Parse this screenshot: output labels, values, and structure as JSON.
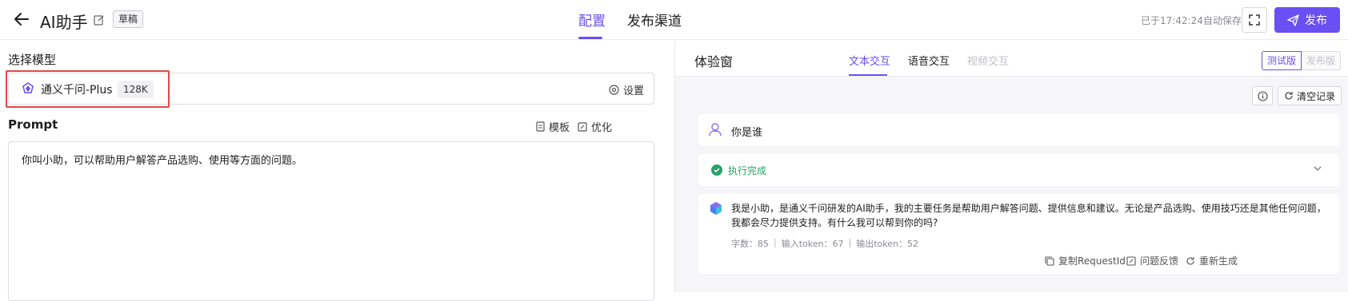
{
  "header": {
    "app_title": "AI助手",
    "draft_badge": "草稿",
    "tabs": [
      "配置",
      "发布渠道"
    ],
    "autosave": "已于17:42:24自动保存",
    "publish_label": "发布"
  },
  "config": {
    "model_section_label": "选择模型",
    "model_name": "通义千问-Plus",
    "context_length": "128K",
    "settings_label": "设置",
    "prompt_label": "Prompt",
    "template_label": "模板",
    "optimize_label": "优化",
    "prompt_text": "你叫小助，可以帮助用户解答产品选购、使用等方面的问题。"
  },
  "preview": {
    "title": "体验窗",
    "tabs": [
      "文本交互",
      "语音交互",
      "视频交互"
    ],
    "version_test": "测试版",
    "version_release": "发布版",
    "clear_label": "清空记录",
    "user_message": "你是谁",
    "status": "执行完成",
    "answer": "我是小助，是通义千问研发的AI助手，我的主要任务是帮助用户解答问题、提供信息和建议。无论是产品选购、使用技巧还是其他任何问题，我都会尽力提供支持。有什么我可以帮到你的吗?",
    "stats": {
      "chars": "字数：85",
      "input_tokens": "输入token：67",
      "output_tokens": "输出token：52"
    },
    "actions": [
      "复制RequestId",
      "问题反馈",
      "重新生成"
    ]
  },
  "colors": {
    "accent": "#6a4ff2",
    "success": "#2aa06a",
    "highlight": "#e04848"
  }
}
